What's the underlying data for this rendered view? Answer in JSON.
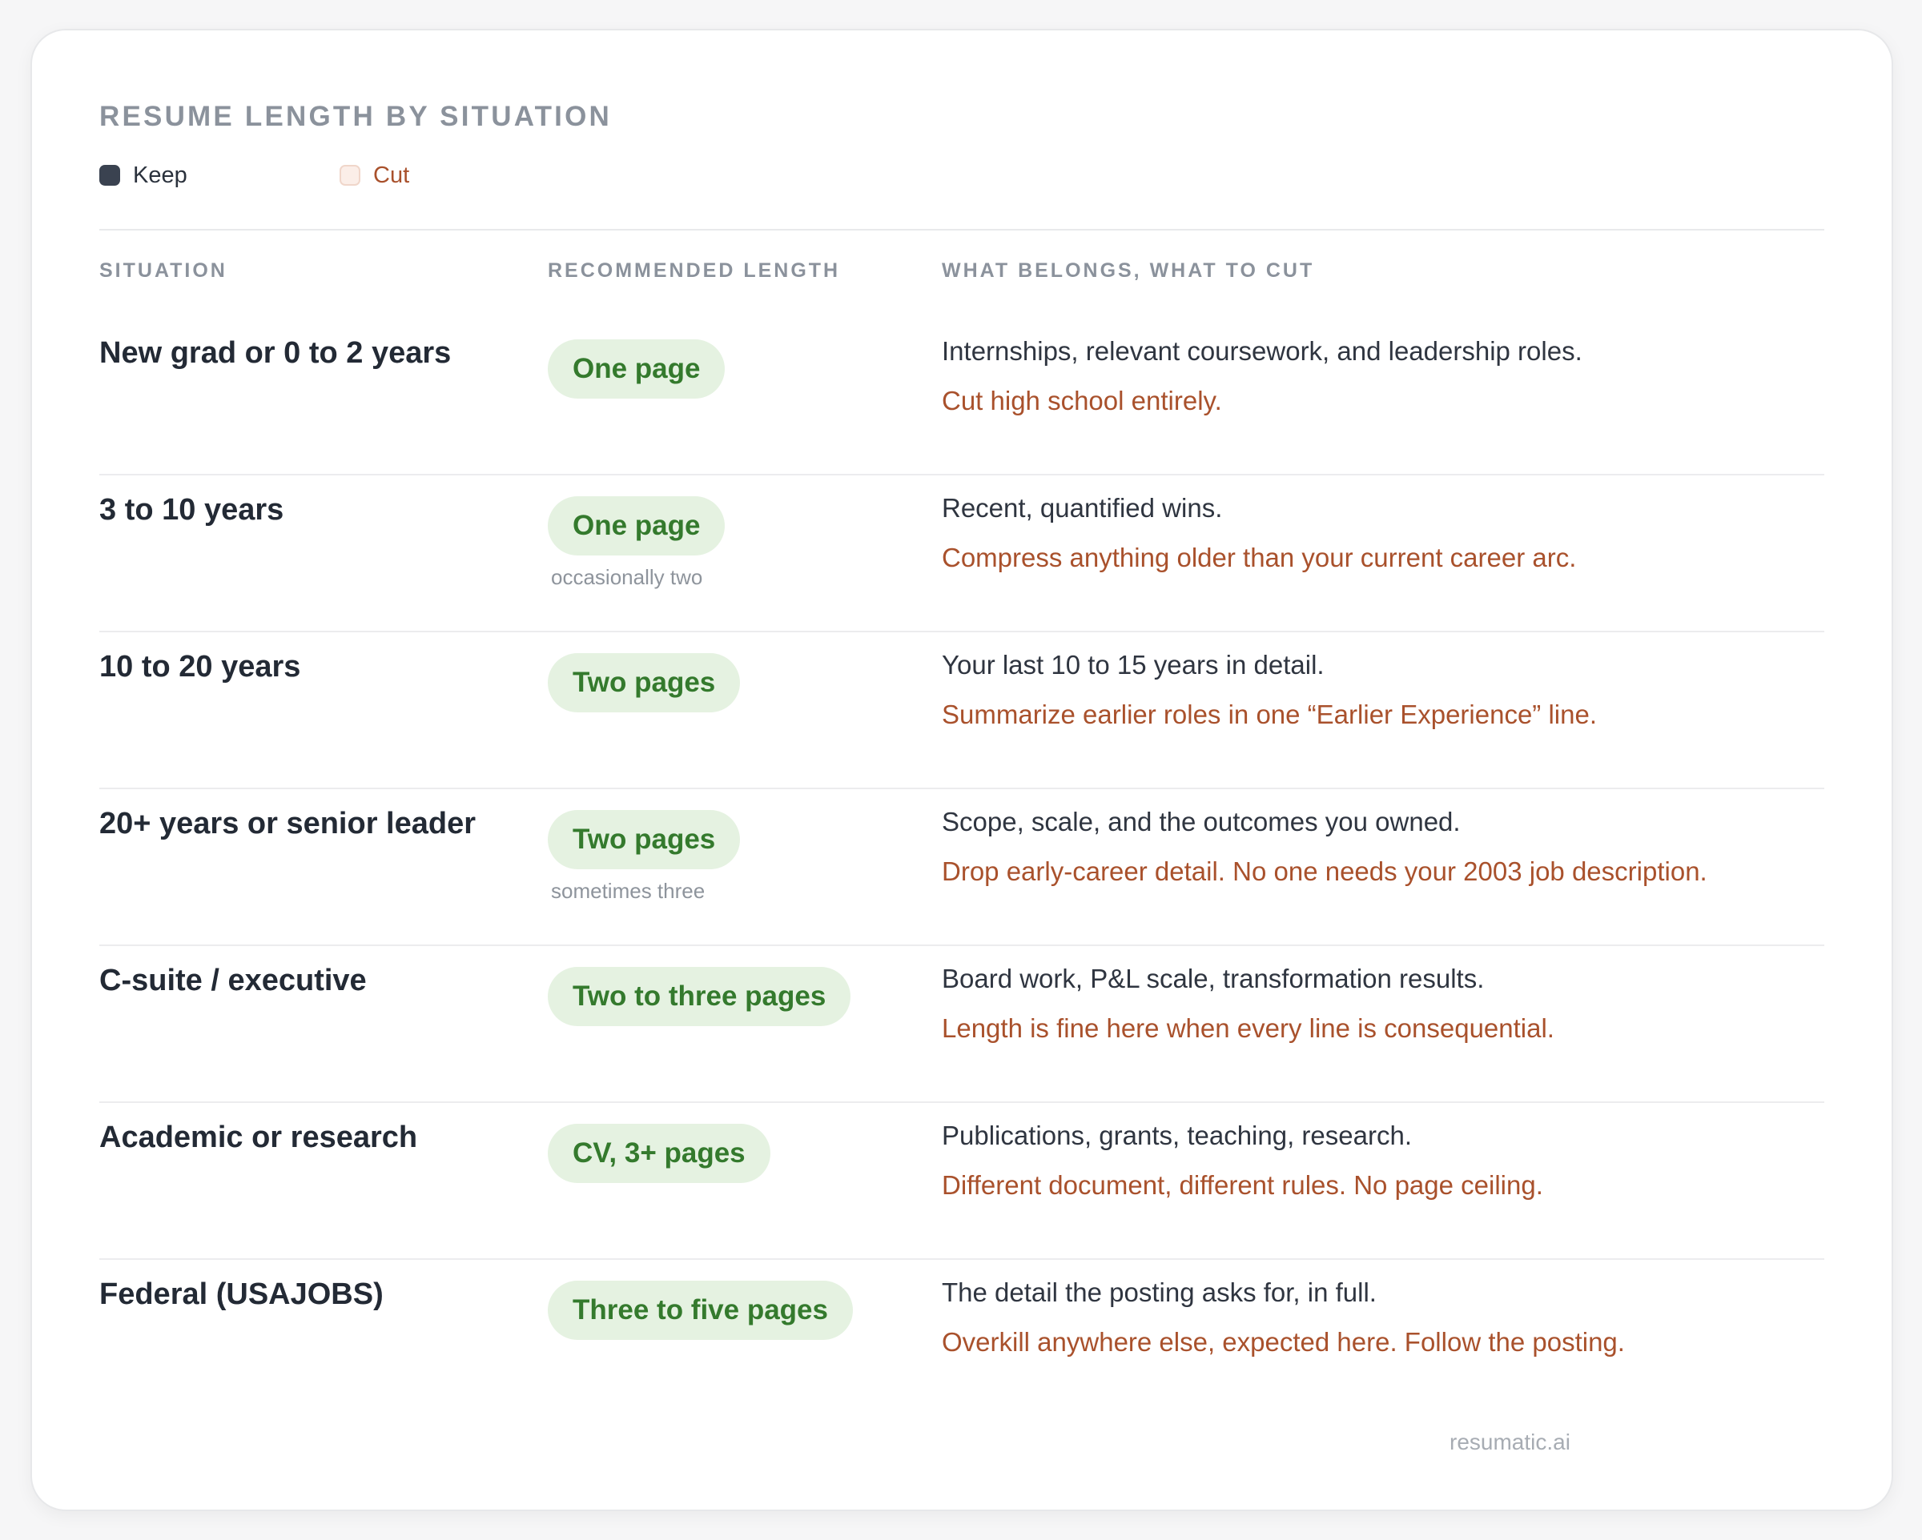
{
  "title": "RESUME LENGTH BY SITUATION",
  "legend": {
    "keep": "Keep",
    "cut": "Cut"
  },
  "columns": {
    "situation": "SITUATION",
    "length": "RECOMMENDED LENGTH",
    "belongs": "WHAT BELONGS, WHAT TO CUT"
  },
  "rows": [
    {
      "situation": "New grad or 0 to 2 years",
      "length": "One page",
      "note": "",
      "keep": "Internships, relevant coursework, and leadership roles.",
      "cut": "Cut high school entirely."
    },
    {
      "situation": "3 to 10 years",
      "length": "One page",
      "note": "occasionally two",
      "keep": "Recent, quantified wins.",
      "cut": "Compress anything older than your current career arc."
    },
    {
      "situation": "10 to 20 years",
      "length": "Two pages",
      "note": "",
      "keep": "Your last 10 to 15 years in detail.",
      "cut": "Summarize earlier roles in one “Earlier Experience” line."
    },
    {
      "situation": "20+ years or senior leader",
      "length": "Two pages",
      "note": "sometimes three",
      "keep": "Scope, scale, and the outcomes you owned.",
      "cut": "Drop early-career detail. No one needs your 2003 job description."
    },
    {
      "situation": "C-suite / executive",
      "length": "Two to three pages",
      "note": "",
      "keep": "Board work, P&L scale, transformation results.",
      "cut": "Length is fine here when every line is consequential."
    },
    {
      "situation": "Academic or research",
      "length": "CV, 3+ pages",
      "note": "",
      "keep": "Publications, grants, teaching, research.",
      "cut": "Different document, different rules. No page ceiling."
    },
    {
      "situation": "Federal (USAJOBS)",
      "length": "Three to five pages",
      "note": "",
      "keep": "The detail the posting asks for, in full.",
      "cut": "Overkill anywhere else, expected here. Follow the posting."
    }
  ],
  "footer": "resumatic.ai",
  "colors": {
    "keep": "#3a4250",
    "cut": "#a9512c",
    "pill_bg": "#e5f2e1",
    "pill_text": "#347a2d"
  }
}
